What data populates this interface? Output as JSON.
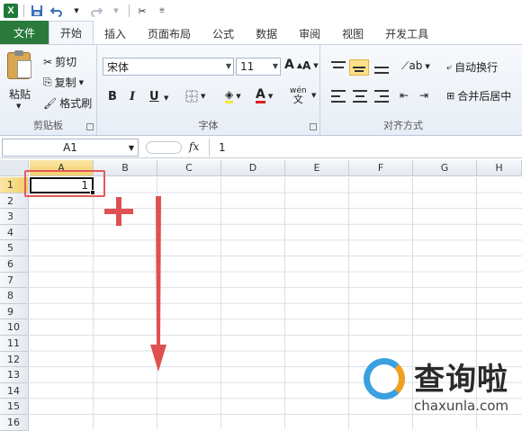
{
  "qat": {
    "undo_icon": "undo-icon",
    "redo_icon": "redo-icon"
  },
  "tabs": [
    {
      "label": "文件"
    },
    {
      "label": "开始"
    },
    {
      "label": "插入"
    },
    {
      "label": "页面布局"
    },
    {
      "label": "公式"
    },
    {
      "label": "数据"
    },
    {
      "label": "审阅"
    },
    {
      "label": "视图"
    },
    {
      "label": "开发工具"
    }
  ],
  "clipboard": {
    "paste": "粘贴",
    "cut": "剪切",
    "copy": "复制",
    "painter": "格式刷",
    "group": "剪贴板"
  },
  "font": {
    "name": "宋体",
    "size": "11",
    "bold": "B",
    "italic": "I",
    "underline": "U",
    "group": "字体",
    "wen": "wén"
  },
  "alignment": {
    "wrap": "自动换行",
    "merge": "合并后居中",
    "group": "对齐方式"
  },
  "formula_bar": {
    "cell_ref": "A1",
    "fx": "fx",
    "value": "1"
  },
  "columns": [
    "A",
    "B",
    "C",
    "D",
    "E",
    "F",
    "G",
    "H"
  ],
  "rows": [
    "1",
    "2",
    "3",
    "4",
    "5",
    "6",
    "7",
    "8",
    "9",
    "10",
    "11",
    "12",
    "13",
    "14",
    "15",
    "16"
  ],
  "cells": {
    "A1": "1"
  },
  "watermark": {
    "title": "查询啦",
    "sub": "chaxunla.com"
  },
  "colors": {
    "file_tab": "#2a7a3b",
    "annotation": "#e05050",
    "selected_header": "#f3cf6a"
  }
}
